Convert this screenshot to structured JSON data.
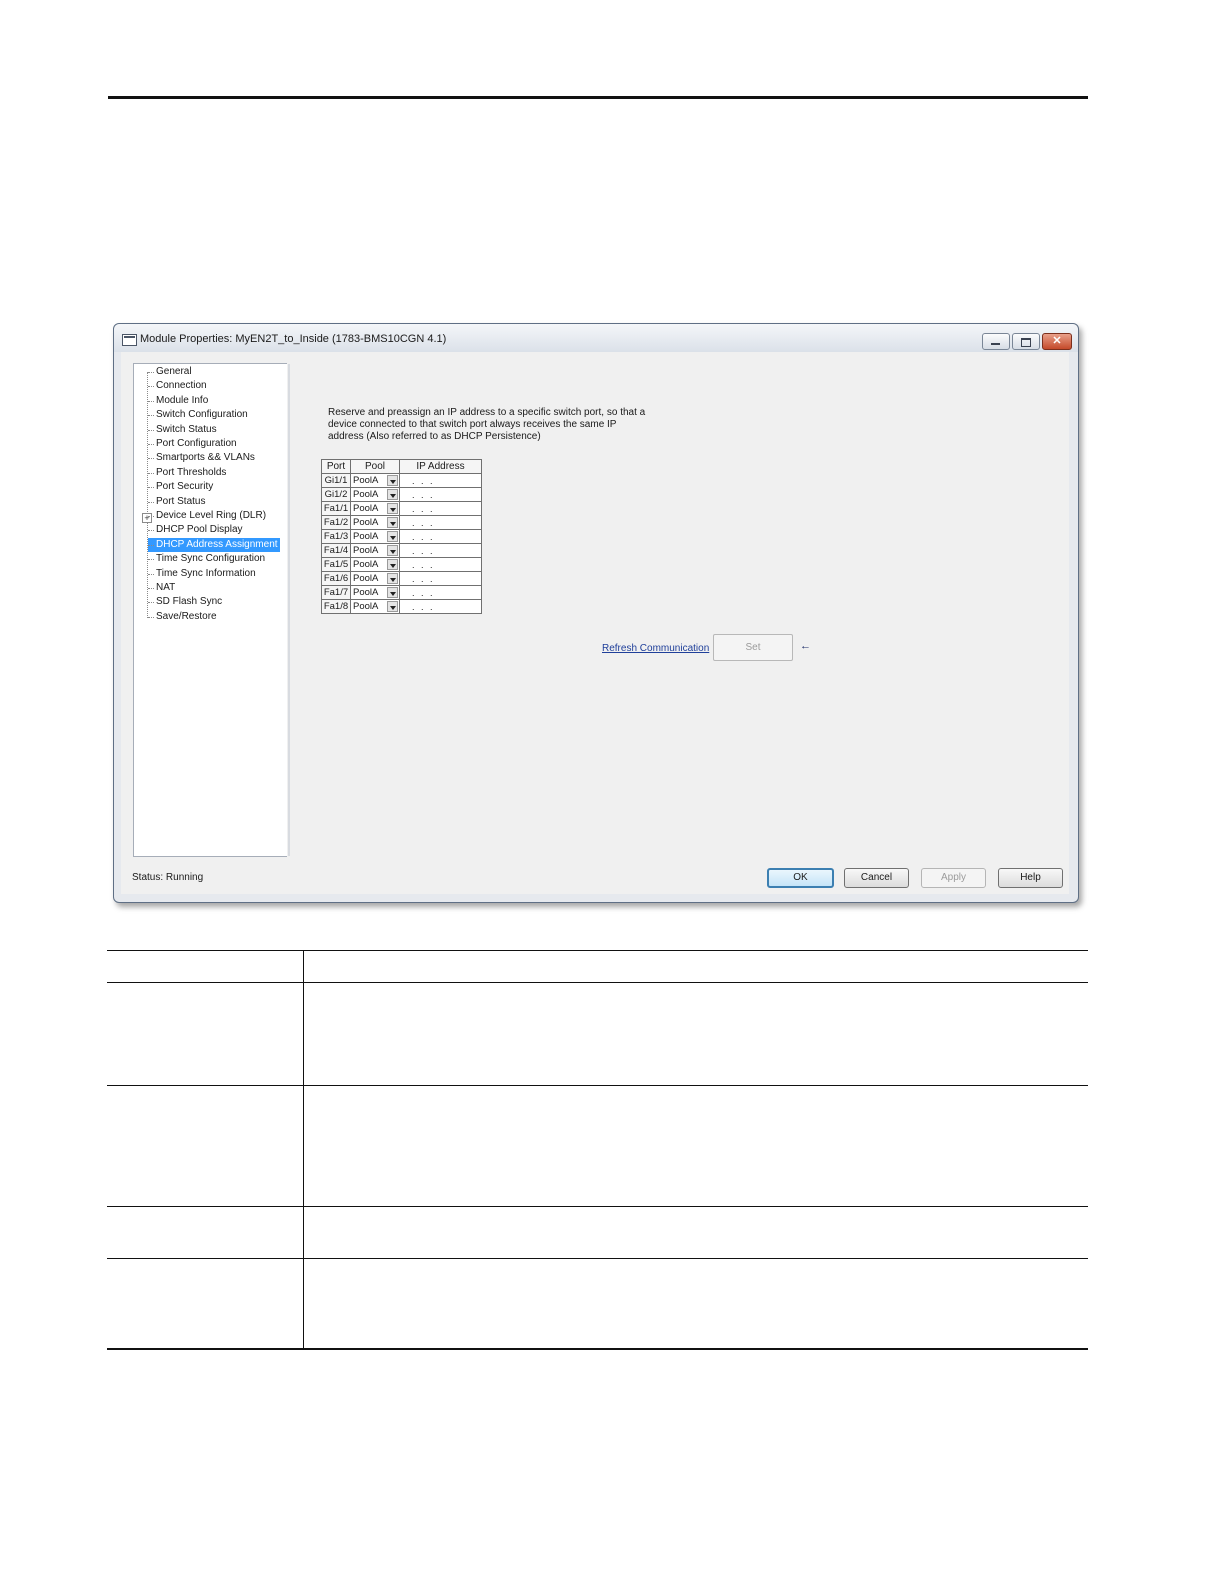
{
  "window": {
    "title": "Module Properties: MyEN2T_to_Inside (1783-BMS10CGN 4.1)"
  },
  "tree": {
    "items": [
      {
        "label": "General"
      },
      {
        "label": "Connection"
      },
      {
        "label": "Module Info"
      },
      {
        "label": "Switch Configuration"
      },
      {
        "label": "Switch Status"
      },
      {
        "label": "Port Configuration"
      },
      {
        "label": "Smartports && VLANs"
      },
      {
        "label": "Port Thresholds"
      },
      {
        "label": "Port Security"
      },
      {
        "label": "Port Status"
      },
      {
        "label": "Device Level Ring (DLR)"
      },
      {
        "label": "DHCP Pool Display"
      },
      {
        "label": "DHCP Address Assignment",
        "selected": true
      },
      {
        "label": "Time Sync Configuration"
      },
      {
        "label": "Time Sync Information"
      },
      {
        "label": "NAT"
      },
      {
        "label": "SD Flash Sync"
      },
      {
        "label": "Save/Restore"
      }
    ]
  },
  "main": {
    "description_lines": [
      "Reserve and preassign an IP address to a specific switch port, so that a",
      "device connected to that switch port always receives the same IP",
      "address (Also referred to as DHCP Persistence)"
    ],
    "table": {
      "headers": [
        "Port",
        "Pool",
        "IP Address"
      ],
      "rows": [
        {
          "port": "Gi1/1",
          "pool": "PoolA",
          "ip": ". . ."
        },
        {
          "port": "Gi1/2",
          "pool": "PoolA",
          "ip": ". . ."
        },
        {
          "port": "Fa1/1",
          "pool": "PoolA",
          "ip": ". . ."
        },
        {
          "port": "Fa1/2",
          "pool": "PoolA",
          "ip": ". . ."
        },
        {
          "port": "Fa1/3",
          "pool": "PoolA",
          "ip": ". . ."
        },
        {
          "port": "Fa1/4",
          "pool": "PoolA",
          "ip": ". . ."
        },
        {
          "port": "Fa1/5",
          "pool": "PoolA",
          "ip": ". . ."
        },
        {
          "port": "Fa1/6",
          "pool": "PoolA",
          "ip": ". . ."
        },
        {
          "port": "Fa1/7",
          "pool": "PoolA",
          "ip": ". . ."
        },
        {
          "port": "Fa1/8",
          "pool": "PoolA",
          "ip": ". . ."
        }
      ]
    },
    "refresh_link": "Refresh Communication",
    "set_button": "Set"
  },
  "footer": {
    "status": "Status:  Running",
    "buttons": {
      "ok": "OK",
      "cancel": "Cancel",
      "apply": "Apply",
      "help": "Help"
    }
  },
  "colors": {
    "selection": "#3399ff",
    "link": "#1f3f9a"
  },
  "icons": [
    "window-app-icon",
    "minimize-icon",
    "maximize-icon",
    "close-icon",
    "expand-icon",
    "dropdown-arrow-icon",
    "arrow-left-icon"
  ]
}
